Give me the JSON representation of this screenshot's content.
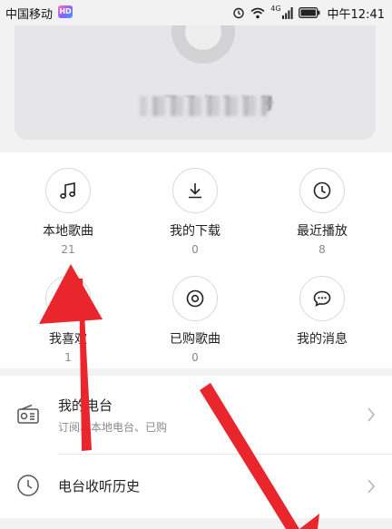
{
  "status_bar": {
    "carrier": "中国移动",
    "carrier_badge": "HD",
    "network": "4G",
    "time": "中午12:41"
  },
  "profile": {
    "username": "登录华为帐号"
  },
  "grid": [
    {
      "label": "本地歌曲",
      "count": "21",
      "icon": "music-note-icon"
    },
    {
      "label": "我的下载",
      "count": "0",
      "icon": "download-icon"
    },
    {
      "label": "最近播放",
      "count": "8",
      "icon": "clock-icon"
    },
    {
      "label": "我喜欢",
      "count": "1",
      "icon": "heart-icon"
    },
    {
      "label": "已购歌曲",
      "count": "0",
      "icon": "disc-icon"
    },
    {
      "label": "我的消息",
      "count": "",
      "icon": "chat-bubble-icon"
    }
  ],
  "list": [
    {
      "title": "我的电台",
      "subtitle": "订阅、本地电台、已购",
      "icon": "radio-icon"
    },
    {
      "title": "电台收听历史",
      "subtitle": "",
      "icon": "history-clock-icon"
    }
  ],
  "colors": {
    "arrow": "#e8262c",
    "background": "#f2f2f2"
  }
}
